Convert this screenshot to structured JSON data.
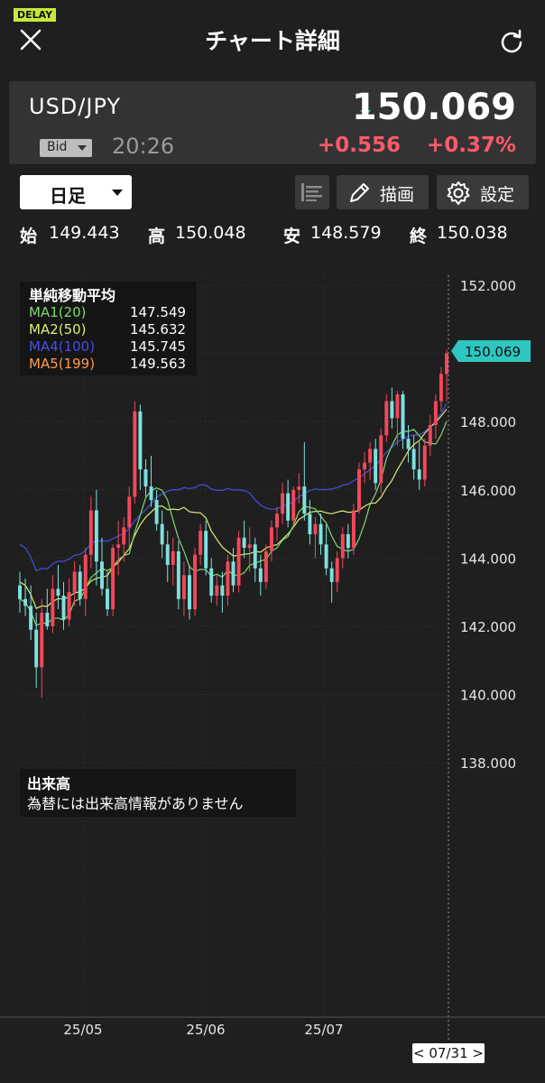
{
  "header": {
    "delay_badge": "DELAY",
    "title": "チャート詳細",
    "close_icon": "close-icon",
    "refresh_icon": "refresh-icon"
  },
  "quote": {
    "pair": "USD/JPY",
    "price": "150.069",
    "price_direction": "down",
    "bid_label": "Bid",
    "time": "20:26",
    "change": "+0.556",
    "change_pct": "+0.37%",
    "down_color": "#2bc48a",
    "up_color": "#ff5a6a"
  },
  "toolbar": {
    "period": "日足",
    "draw_label": "描画",
    "settings_label": "設定"
  },
  "ohlc": {
    "open_label": "始",
    "open": "149.443",
    "high_label": "高",
    "high": "150.048",
    "low_label": "安",
    "low": "148.579",
    "close_label": "終",
    "close": "150.038"
  },
  "indicator_panel": {
    "title": "単純移動平均",
    "items": [
      {
        "name": "MA1(20)",
        "value": "147.549",
        "color": "#7ed96f"
      },
      {
        "name": "MA2(50)",
        "value": "145.632",
        "color": "#d8ef73"
      },
      {
        "name": "MA4(100)",
        "value": "145.745",
        "color": "#4350e6"
      },
      {
        "name": "MA5(199)",
        "value": "149.563",
        "color": "#ff9a4a"
      }
    ]
  },
  "volume_panel": {
    "title": "出来高",
    "message": "為替には出来高情報がありません"
  },
  "chart_data": {
    "type": "candlestick",
    "y_ticks": [
      "152.000",
      "150.000",
      "148.000",
      "146.000",
      "144.000",
      "142.000",
      "140.000",
      "138.000"
    ],
    "ylim": [
      137.2,
      152.0
    ],
    "x_ticks": [
      "25/05",
      "25/06",
      "25/07"
    ],
    "current_price_label": "150.069",
    "date_selector": "< 07/31 >",
    "up_color": "#f2485a",
    "down_color": "#7fe0de",
    "ma_colors": {
      "ma20": "#7ed96f",
      "ma50": "#d8ef73",
      "ma100": "#4350e6"
    },
    "candles": [
      [
        143.2,
        143.6,
        142.4,
        142.8
      ],
      [
        142.8,
        143.4,
        142.3,
        142.6
      ],
      [
        142.6,
        143.2,
        141.6,
        141.9
      ],
      [
        141.9,
        142.4,
        140.2,
        140.8
      ],
      [
        140.8,
        142.8,
        139.9,
        142.4
      ],
      [
        142.4,
        143.1,
        141.9,
        142.0
      ],
      [
        142.0,
        143.5,
        141.8,
        143.1
      ],
      [
        143.1,
        143.8,
        142.5,
        142.9
      ],
      [
        142.9,
        143.3,
        141.9,
        142.2
      ],
      [
        142.2,
        143.4,
        142.0,
        143.0
      ],
      [
        143.0,
        143.9,
        142.6,
        143.6
      ],
      [
        143.6,
        143.8,
        142.6,
        142.8
      ],
      [
        142.8,
        144.3,
        142.3,
        144.1
      ],
      [
        144.1,
        145.8,
        143.7,
        145.4
      ],
      [
        145.4,
        146.0,
        143.2,
        143.9
      ],
      [
        143.9,
        144.6,
        142.9,
        143.1
      ],
      [
        143.1,
        143.6,
        142.3,
        142.5
      ],
      [
        142.5,
        144.4,
        142.3,
        144.3
      ],
      [
        144.3,
        145.1,
        143.5,
        144.4
      ],
      [
        144.4,
        145.2,
        143.9,
        144.9
      ],
      [
        144.9,
        146.1,
        144.3,
        145.8
      ],
      [
        145.8,
        148.6,
        145.6,
        148.3
      ],
      [
        148.3,
        148.5,
        146.0,
        146.6
      ],
      [
        146.6,
        146.9,
        145.8,
        146.1
      ],
      [
        146.1,
        147.0,
        145.5,
        145.7
      ],
      [
        145.7,
        146.0,
        144.8,
        145.0
      ],
      [
        145.0,
        145.4,
        144.0,
        144.4
      ],
      [
        144.4,
        144.8,
        143.3,
        143.8
      ],
      [
        143.8,
        144.6,
        143.2,
        144.2
      ],
      [
        144.2,
        144.5,
        142.5,
        142.8
      ],
      [
        142.8,
        143.9,
        142.3,
        143.5
      ],
      [
        143.5,
        143.8,
        142.2,
        142.5
      ],
      [
        142.5,
        144.3,
        142.3,
        144.1
      ],
      [
        144.1,
        145.0,
        143.8,
        144.8
      ],
      [
        144.8,
        145.1,
        143.5,
        143.7
      ],
      [
        143.7,
        144.0,
        142.7,
        142.9
      ],
      [
        142.9,
        143.5,
        142.6,
        143.2
      ],
      [
        143.2,
        143.6,
        142.4,
        142.9
      ],
      [
        142.9,
        144.1,
        142.6,
        143.9
      ],
      [
        143.9,
        144.3,
        143.0,
        143.2
      ],
      [
        143.2,
        144.8,
        143.0,
        144.6
      ],
      [
        144.6,
        145.1,
        144.0,
        144.3
      ],
      [
        144.3,
        144.9,
        143.6,
        144.4
      ],
      [
        144.4,
        144.6,
        143.3,
        143.7
      ],
      [
        143.7,
        144.1,
        142.9,
        143.3
      ],
      [
        143.3,
        144.4,
        143.1,
        144.2
      ],
      [
        144.2,
        145.1,
        143.9,
        144.9
      ],
      [
        144.9,
        145.5,
        144.5,
        145.3
      ],
      [
        145.3,
        146.2,
        145.0,
        145.9
      ],
      [
        145.9,
        146.3,
        144.9,
        145.1
      ],
      [
        145.1,
        146.1,
        144.9,
        146.0
      ],
      [
        146.0,
        146.5,
        145.6,
        146.1
      ],
      [
        146.1,
        147.4,
        145.1,
        145.3
      ],
      [
        145.3,
        145.7,
        144.4,
        144.7
      ],
      [
        144.7,
        145.2,
        144.0,
        145.0
      ],
      [
        145.0,
        145.3,
        144.1,
        144.4
      ],
      [
        144.4,
        145.0,
        143.5,
        143.7
      ],
      [
        143.7,
        143.9,
        142.7,
        143.3
      ],
      [
        143.3,
        144.2,
        143.0,
        144.0
      ],
      [
        144.0,
        144.9,
        143.7,
        144.7
      ],
      [
        144.7,
        145.0,
        144.0,
        144.3
      ],
      [
        144.3,
        145.6,
        144.1,
        145.4
      ],
      [
        145.4,
        146.8,
        145.3,
        146.6
      ],
      [
        146.6,
        147.1,
        146.2,
        146.8
      ],
      [
        146.8,
        147.4,
        146.3,
        147.2
      ],
      [
        147.2,
        147.5,
        146.0,
        146.2
      ],
      [
        146.2,
        147.8,
        145.9,
        147.6
      ],
      [
        147.6,
        148.8,
        147.4,
        148.6
      ],
      [
        148.6,
        149.0,
        147.8,
        148.1
      ],
      [
        148.1,
        148.9,
        147.3,
        148.8
      ],
      [
        148.8,
        148.9,
        147.2,
        147.5
      ],
      [
        147.5,
        147.9,
        146.8,
        147.2
      ],
      [
        147.2,
        147.6,
        146.3,
        146.6
      ],
      [
        146.6,
        147.4,
        146.0,
        146.3
      ],
      [
        146.3,
        147.5,
        146.1,
        147.3
      ],
      [
        147.3,
        148.2,
        147.0,
        147.9
      ],
      [
        147.9,
        148.8,
        147.5,
        148.6
      ],
      [
        148.6,
        149.6,
        148.3,
        149.4
      ],
      [
        149.4,
        150.1,
        148.6,
        150.0
      ]
    ]
  }
}
